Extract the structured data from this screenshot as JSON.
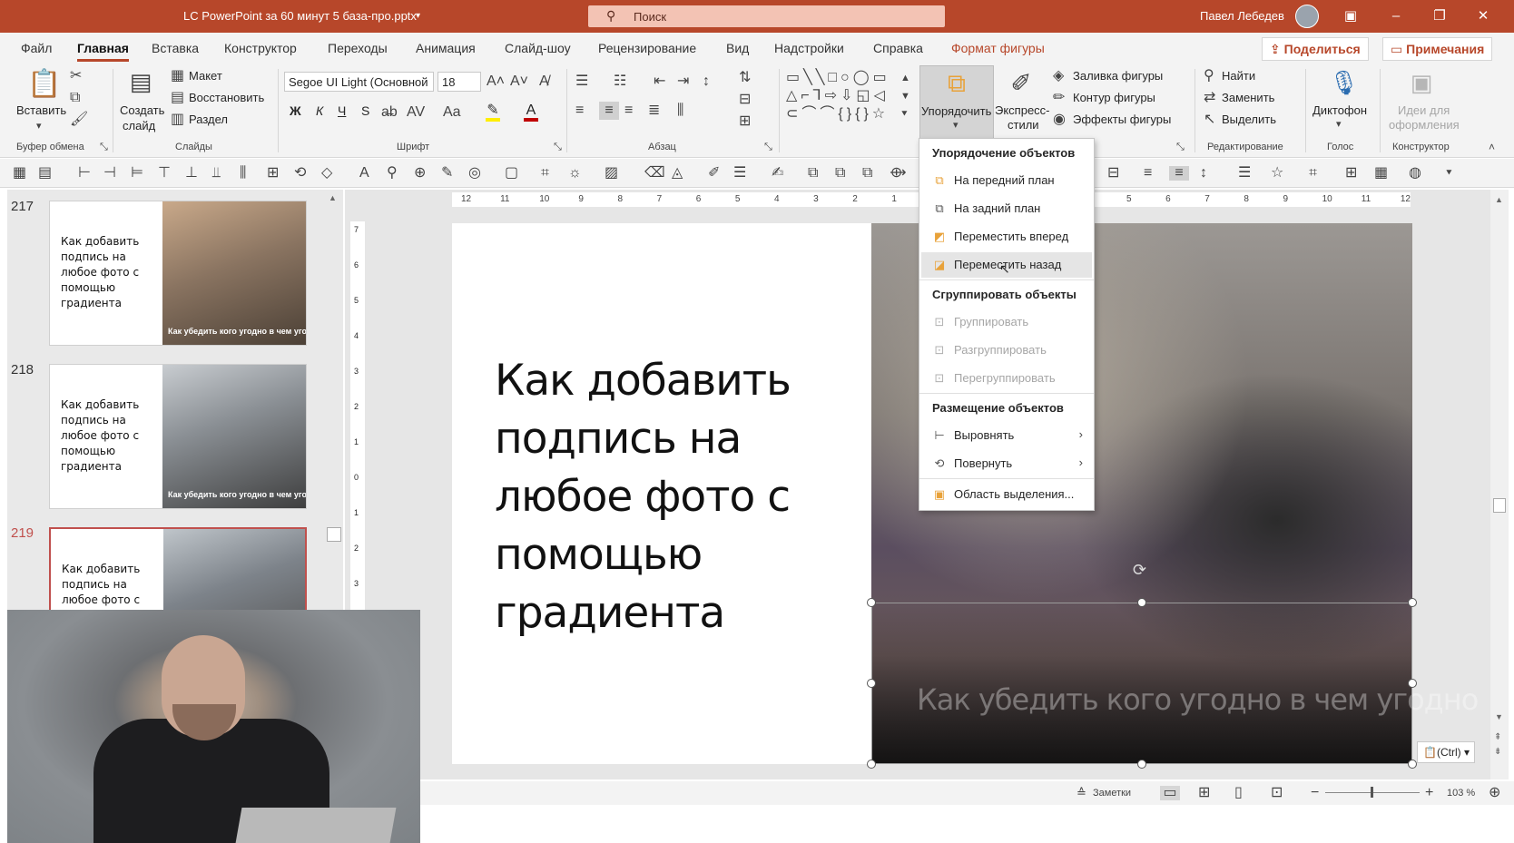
{
  "title_bar": {
    "filename": "LC PowerPoint за 60 минут 5 база-про.pptx",
    "search_placeholder": "Поиск",
    "user_name": "Павел Лебедев"
  },
  "menu": {
    "tabs": [
      "Файл",
      "Главная",
      "Вставка",
      "Конструктор",
      "Переходы",
      "Анимация",
      "Слайд-шоу",
      "Рецензирование",
      "Вид",
      "Надстройки",
      "Справка",
      "Формат фигуры"
    ],
    "active_tab": "Главная",
    "share_label": "Поделиться",
    "comments_label": "Примечания"
  },
  "ribbon": {
    "clipboard": {
      "paste": "Вставить",
      "group": "Буфер обмена"
    },
    "slides": {
      "new_slide_1": "Создать",
      "new_slide_2": "слайд",
      "layout": "Макет",
      "reset": "Восстановить",
      "section": "Раздел",
      "group": "Слайды"
    },
    "font": {
      "family": "Segoe UI Light (Основной",
      "size": "18",
      "bold": "Ж",
      "italic": "К",
      "underline": "Ч",
      "strike": "S",
      "group": "Шрифт"
    },
    "paragraph": {
      "group": "Абзац"
    },
    "drawing": {
      "arrange_1": "Упорядочить",
      "styles_1": "Экспресс-",
      "styles_2": "стили",
      "fill": "Заливка фигуры",
      "outline": "Контур фигуры",
      "effects": "Эффекты фигуры"
    },
    "editing": {
      "find": "Найти",
      "replace": "Заменить",
      "select": "Выделить",
      "group": "Редактирование"
    },
    "voice": {
      "dictate": "Диктофон",
      "group": "Голос"
    },
    "designer": {
      "ideas_1": "Идеи для",
      "ideas_2": "оформления",
      "group": "Конструктор"
    }
  },
  "slides_pane": {
    "items": [
      {
        "number": "217",
        "title": "Как добавить подпись на любое фото с помощью градиента",
        "caption": "Как убедить кого угодно в чем угодно"
      },
      {
        "number": "218",
        "title": "Как добавить подпись на любое фото с помощью градиента",
        "caption": "Как убедить кого угодно в чем угодно"
      },
      {
        "number": "219",
        "title": "Как добавить подпись на любое фото с помощью",
        "caption": ""
      }
    ]
  },
  "slide": {
    "title": "Как добавить подпись на любое фото с помощью градиента",
    "caption": "Как убедить кого угодно в чем угодно"
  },
  "arrange_menu": {
    "section1": "Упорядочение объектов",
    "bring_front": "На передний план",
    "send_back": "На задний план",
    "bring_forward": "Переместить вперед",
    "send_backward": "Переместить назад",
    "section2": "Сгруппировать объекты",
    "group": "Группировать",
    "ungroup": "Разгруппировать",
    "regroup": "Перегруппировать",
    "section3": "Размещение объектов",
    "align": "Выровнять",
    "rotate": "Повернуть",
    "selection_pane": "Область выделения..."
  },
  "paste_options": "(Ctrl)",
  "status_bar": {
    "notes": "Заметки",
    "zoom": "103 %"
  },
  "ruler_top": [
    "12",
    "11",
    "10",
    "9",
    "8",
    "7",
    "6",
    "5",
    "4",
    "3",
    "2",
    "1",
    "0",
    "1",
    "2",
    "3",
    "4",
    "5",
    "6",
    "7",
    "8",
    "9",
    "10",
    "11",
    "12"
  ],
  "ruler_left": [
    "7",
    "6",
    "5",
    "4",
    "3",
    "2",
    "1",
    "0",
    "1",
    "2",
    "3"
  ],
  "colors": {
    "accent": "#b7472a",
    "selected_slide": "#c0504d"
  }
}
